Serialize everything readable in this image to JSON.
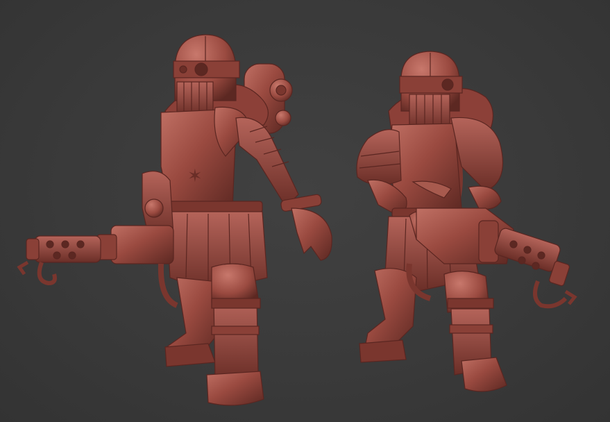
{
  "scene": {
    "background_color": "#3a3a3a",
    "model_base_color": "#9a4a40",
    "model_shadow_color": "#5c2822",
    "model_highlight_color": "#c07064",
    "figures": [
      {
        "name": "figure-left",
        "weapon": "rotary-gun-left"
      },
      {
        "name": "figure-right",
        "weapon": "rotary-gun-right"
      }
    ]
  }
}
